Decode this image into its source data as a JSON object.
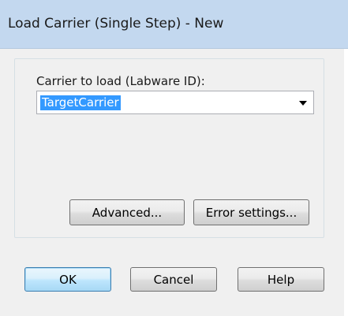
{
  "window": {
    "title": "Load Carrier (Single Step) - New"
  },
  "form": {
    "carrier_label": "Carrier to load (Labware ID):",
    "carrier_value": "TargetCarrier",
    "dropdown_icon": "chevron-down-icon"
  },
  "buttons": {
    "advanced": "Advanced...",
    "error_settings": "Error settings...",
    "ok": "OK",
    "cancel": "Cancel",
    "help": "Help"
  },
  "colors": {
    "titlebar": "#c3d8ef",
    "dialog_background": "#f0f0f0",
    "selection": "#3399ff",
    "default_button_border": "#3c7fb1"
  }
}
